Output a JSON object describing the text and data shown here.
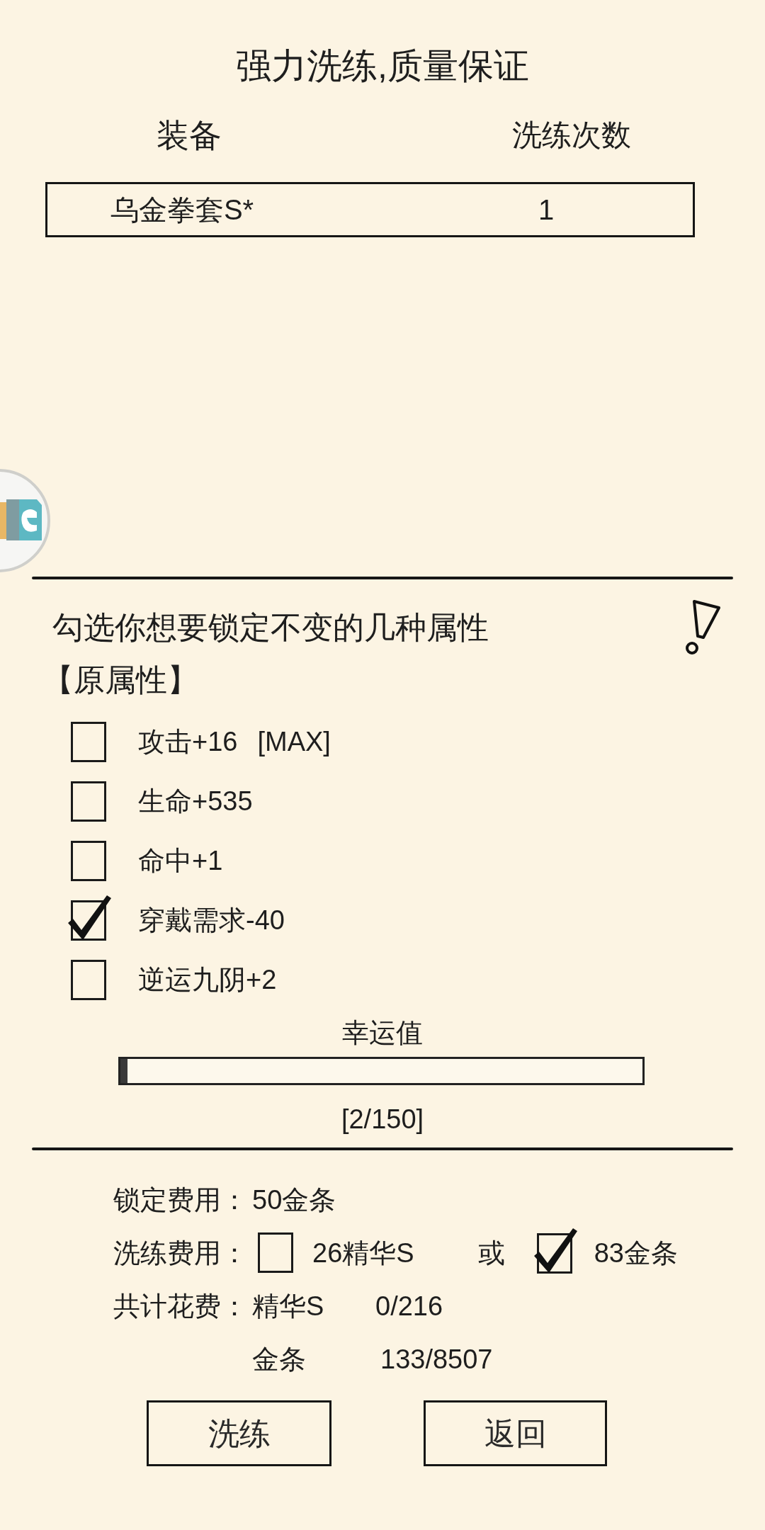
{
  "title": "强力洗练,质量保证",
  "equipment_table": {
    "columns": [
      "装备",
      "洗练次数"
    ],
    "rows": [
      {
        "name": "乌金拳套S*",
        "refine_count": "1"
      }
    ]
  },
  "lock_section": {
    "instruction": "勾选你想要锁定不变的几种属性",
    "group_label": "【原属性】",
    "attributes": [
      {
        "label": "攻击+16",
        "tag": "[MAX]",
        "checked": false
      },
      {
        "label": "生命+535",
        "checked": false
      },
      {
        "label": "命中+1",
        "checked": false
      },
      {
        "label": "穿戴需求-40",
        "checked": true
      },
      {
        "label": "逆运九阴+2",
        "checked": false
      }
    ]
  },
  "luck": {
    "label": "幸运值",
    "level": 0.013,
    "reading": "[2/150]"
  },
  "costs": {
    "lock_fee": {
      "label": "锁定费用：",
      "value": "50金条"
    },
    "refine_fee": {
      "label": "洗练费用：",
      "options": [
        {
          "label": "26精华S",
          "checked": false
        },
        {
          "label": "83金条",
          "checked": true
        }
      ],
      "separator": "或"
    },
    "total": {
      "label": "共计花费：",
      "items": [
        {
          "name": "精华S",
          "amount": "0/216"
        },
        {
          "name": "金条",
          "amount": "133/8507"
        }
      ]
    }
  },
  "buttons": [
    {
      "label": "洗练"
    },
    {
      "label": "返回"
    }
  ]
}
